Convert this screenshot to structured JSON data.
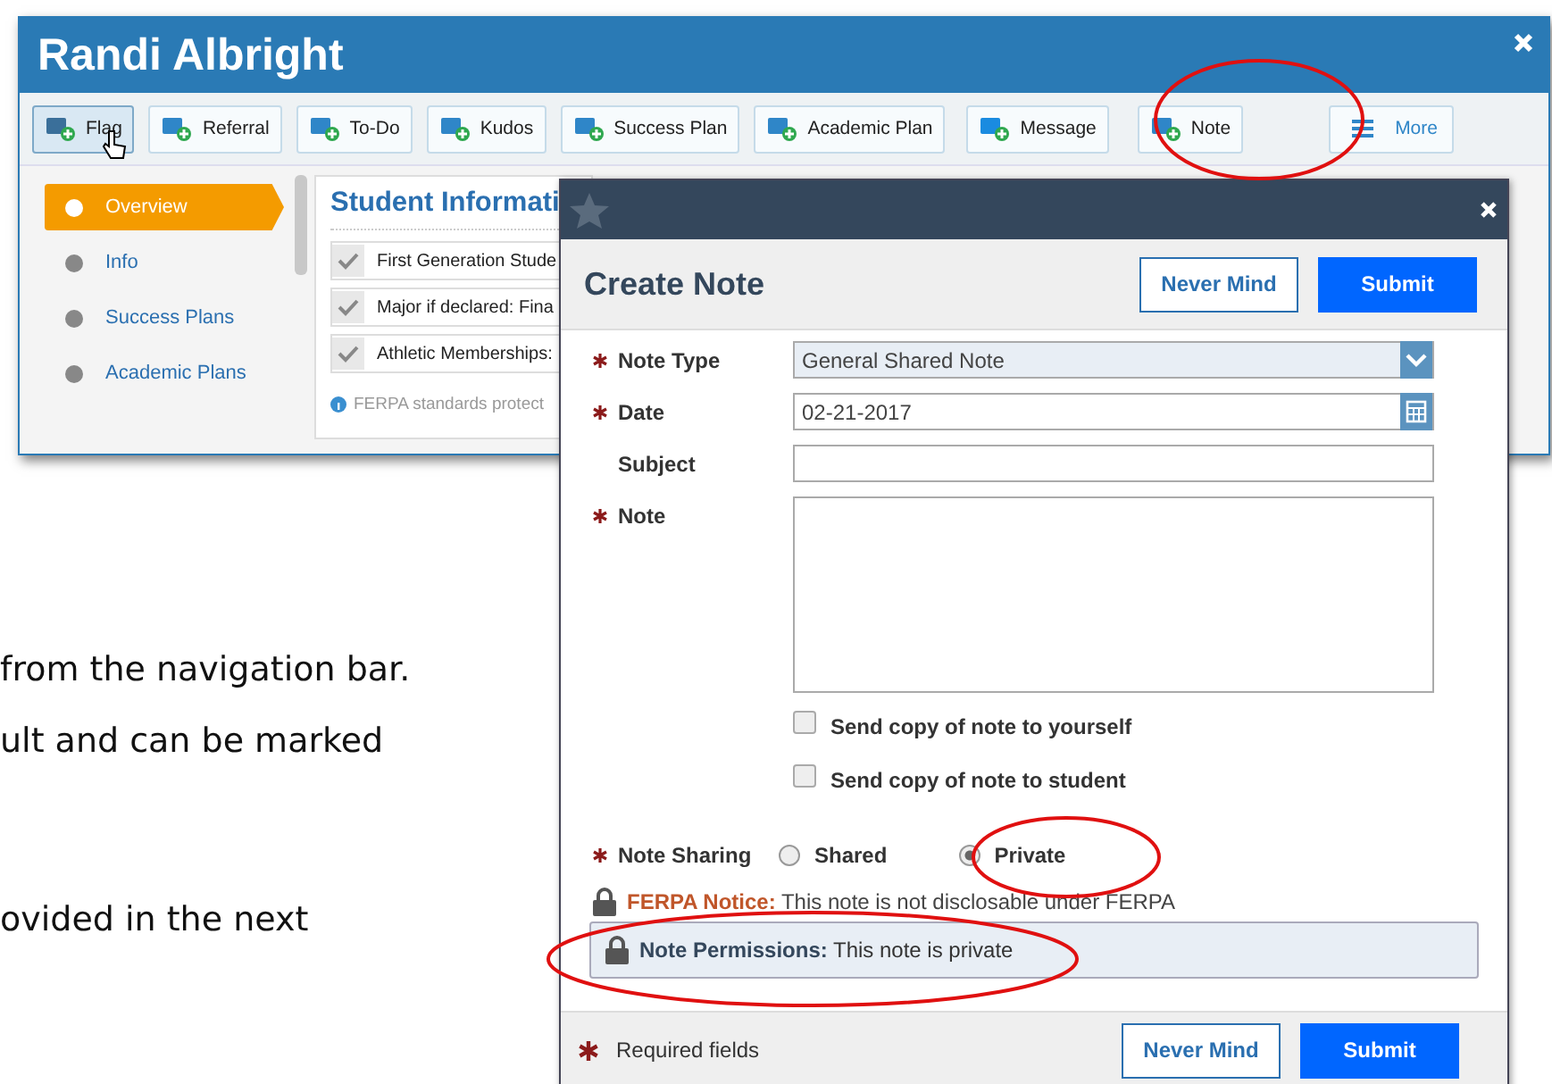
{
  "main_window": {
    "title": "Randi Albright",
    "toolbar": [
      {
        "label": "Flag",
        "hovered": true
      },
      {
        "label": "Referral",
        "hovered": false
      },
      {
        "label": "To-Do",
        "hovered": false
      },
      {
        "label": "Kudos",
        "hovered": false
      },
      {
        "label": "Success Plan",
        "hovered": false
      },
      {
        "label": "Academic Plan",
        "hovered": false
      },
      {
        "label": "Message",
        "hovered": false
      },
      {
        "label": "Note",
        "hovered": false
      },
      {
        "label": "More",
        "hovered": false
      }
    ],
    "sidebar": [
      {
        "label": "Overview",
        "selected": true
      },
      {
        "label": "Info",
        "selected": false
      },
      {
        "label": "Success Plans",
        "selected": false
      },
      {
        "label": "Academic Plans",
        "selected": false
      }
    ],
    "student_information": {
      "title": "Student Informati",
      "rows": [
        "First Generation Stude",
        "Major if declared: Fina",
        "Athletic Memberships:"
      ],
      "footer": "FERPA standards protect"
    }
  },
  "modal": {
    "title": "Create Note",
    "header_buttons": [
      {
        "label": "Never Mind",
        "kind": "secondary"
      },
      {
        "label": "Submit",
        "kind": "primary"
      }
    ],
    "fields": [
      {
        "label": "Note Type",
        "required": true,
        "kind": "select",
        "value": "General Shared Note"
      },
      {
        "label": "Date",
        "required": true,
        "kind": "date",
        "value": "02-21-2017"
      },
      {
        "label": "Subject",
        "required": false,
        "kind": "text"
      },
      {
        "label": "Note",
        "required": true,
        "kind": "textarea"
      }
    ],
    "checkboxes": [
      {
        "label": "Send copy of note to yourself",
        "checked": false
      },
      {
        "label": "Send copy of note to student",
        "checked": false
      }
    ],
    "note_sharing": {
      "label": "Note Sharing",
      "required": true,
      "options": [
        {
          "label": "Shared",
          "selected": false
        },
        {
          "label": "Private",
          "selected": true
        }
      ]
    },
    "ferpa_notice": "**FERPA Notice:** This note is not disclosable under FERPA",
    "permissions": "**Note Permissions:** This note is private",
    "footer": {
      "required_note": "Required fields",
      "buttons": [
        {
          "label": "Never Mind",
          "kind": "secondary"
        },
        {
          "label": "Submit",
          "kind": "primary"
        }
      ]
    }
  },
  "document_lines": [
    "from the navigation bar.",
    "ult and can be marked",
    "ovided in the next"
  ]
}
